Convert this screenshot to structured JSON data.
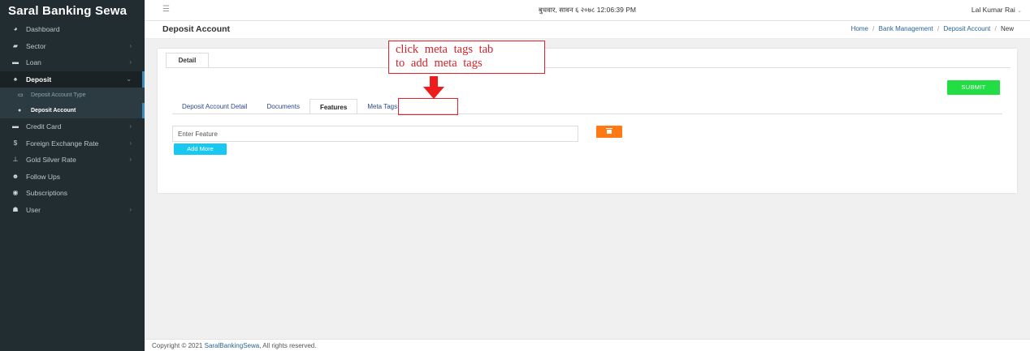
{
  "sidebar": {
    "brand": "Saral Banking Sewa",
    "items": [
      {
        "label": "Dashboard",
        "icon": "dashboard-icon",
        "has_children": false
      },
      {
        "label": "Sector",
        "icon": "sector-icon",
        "has_children": true
      },
      {
        "label": "Loan",
        "icon": "loan-icon",
        "has_children": true
      },
      {
        "label": "Deposit",
        "icon": "deposit-icon",
        "has_children": true,
        "expanded": true
      },
      {
        "label": "Credit Card",
        "icon": "credit-card-icon",
        "has_children": true
      },
      {
        "label": "Foreign Exchange Rate",
        "icon": "dollar-icon",
        "has_children": true
      },
      {
        "label": "Gold Silver Rate",
        "icon": "gold-icon",
        "has_children": true
      },
      {
        "label": "Follow Ups",
        "icon": "user-plus-icon",
        "has_children": false
      },
      {
        "label": "Subscriptions",
        "icon": "subscriptions-icon",
        "has_children": false
      },
      {
        "label": "User",
        "icon": "users-icon",
        "has_children": true
      }
    ],
    "deposit_sub": [
      {
        "label": "Deposit Account Type",
        "icon": "card-icon"
      },
      {
        "label": "Deposit Account",
        "icon": "info-circle-icon"
      }
    ]
  },
  "topbar": {
    "datetime": "बुधवार, सावन ६ २०७८ 12:06:39 PM",
    "user": "Lal Kumar Rai"
  },
  "header": {
    "title": "Deposit Account",
    "breadcrumb": [
      "Home",
      "Bank Management",
      "Deposit Account",
      "New"
    ]
  },
  "form": {
    "detail_tab": "Detail",
    "submit_label": "SUBMIT",
    "tabs": [
      "Deposit Account Detail",
      "Documents",
      "Features",
      "Meta Tags"
    ],
    "active_tab": "Features",
    "feature_placeholder": "Enter Feature",
    "add_more_label": "Add More"
  },
  "annotation": {
    "line1": "click meta tags tab",
    "line2": "to add meta tags"
  },
  "footer": {
    "prefix": "Copyright © 2021",
    "link": "SaralBankingSewa",
    "suffix": ", All rights reserved."
  },
  "colors": {
    "sidebar_bg": "#222d32",
    "submit": "#22dd44",
    "delete": "#ff7a14",
    "add_more": "#18c8f0",
    "annotation": "#e8202a",
    "link": "#2a6496"
  }
}
